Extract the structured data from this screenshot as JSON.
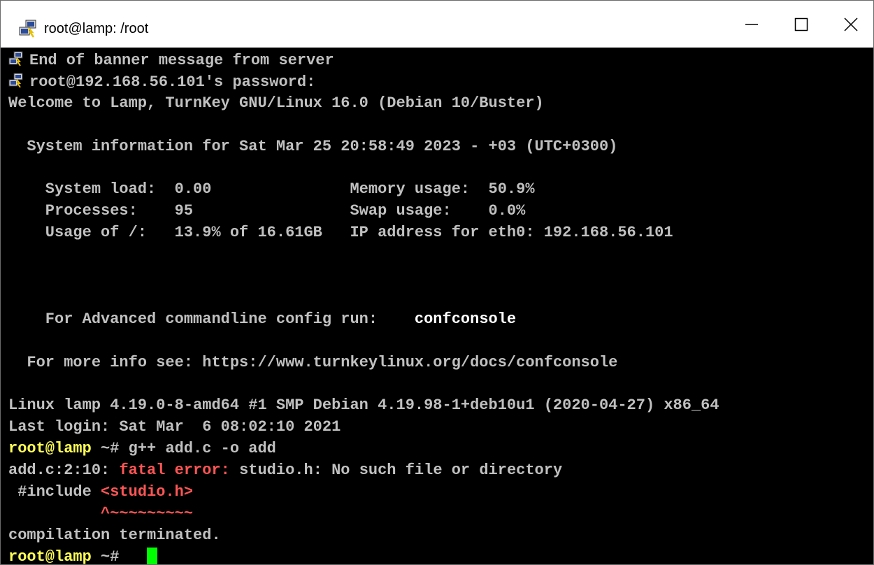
{
  "window": {
    "title": "root@lamp: /root"
  },
  "terminal": {
    "banner_end": "End of banner message from server",
    "password_prompt": "root@192.168.56.101's password:",
    "welcome": "Welcome to Lamp, TurnKey GNU/Linux 16.0 (Debian 10/Buster)",
    "sysinfo_header": "  System information for Sat Mar 25 20:58:49 2023 - +03 (UTC+0300)",
    "sysinfo_row1": "    System load:  0.00               Memory usage:  50.9%",
    "sysinfo_row2": "    Processes:    95                 Swap usage:    0.0%",
    "sysinfo_row3": "    Usage of /:   13.9% of 16.61GB   IP address for eth0: 192.168.56.101",
    "confconsole_label": "    For Advanced commandline config run:    ",
    "confconsole_cmd": "confconsole",
    "more_info": "  For more info see: https://www.turnkeylinux.org/docs/confconsole",
    "uname": "Linux lamp 4.19.0-8-amd64 #1 SMP Debian 4.19.98-1+deb10u1 (2020-04-27) x86_64",
    "last_login": "Last login: Sat Mar  6 08:02:10 2021",
    "prompt_host": "root@lamp",
    "prompt_suffix": " ~# ",
    "command": "g++ add.c -o add",
    "error_location": "add.c:2:10: ",
    "error_label": "fatal error:",
    "error_message": " studio.h: No such file or directory",
    "include_directive": " #include ",
    "include_file": "<studio.h>",
    "caret_padding": "          ",
    "caret_marker": "^~~~~~~~~~",
    "compilation_terminated": "compilation terminated."
  },
  "colors": {
    "background": "#000000",
    "text": "#c0c0c0",
    "prompt": "#ffff55",
    "error": "#ff5555",
    "cursor": "#00ff00"
  }
}
